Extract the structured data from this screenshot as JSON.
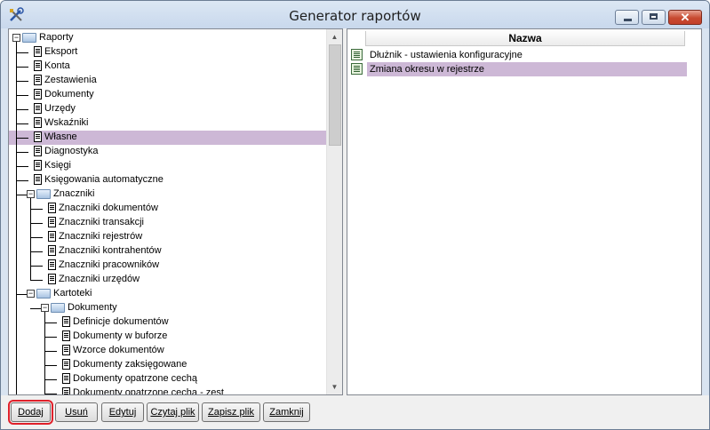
{
  "window": {
    "title": "Generator raportów"
  },
  "tree": [
    {
      "label": "Raporty",
      "type": "folder",
      "depth": 0,
      "expanded": true
    },
    {
      "label": "Eksport",
      "type": "doc",
      "depth": 1
    },
    {
      "label": "Konta",
      "type": "doc",
      "depth": 1
    },
    {
      "label": "Zestawienia",
      "type": "doc",
      "depth": 1
    },
    {
      "label": "Dokumenty",
      "type": "doc",
      "depth": 1
    },
    {
      "label": "Urzędy",
      "type": "doc",
      "depth": 1
    },
    {
      "label": "Wskaźniki",
      "type": "doc",
      "depth": 1
    },
    {
      "label": "Własne",
      "type": "doc",
      "depth": 1,
      "selected": true
    },
    {
      "label": "Diagnostyka",
      "type": "doc",
      "depth": 1
    },
    {
      "label": "Księgi",
      "type": "doc",
      "depth": 1
    },
    {
      "label": "Księgowania automatyczne",
      "type": "doc",
      "depth": 1
    },
    {
      "label": "Znaczniki",
      "type": "folder",
      "depth": 1,
      "expanded": true
    },
    {
      "label": "Znaczniki dokumentów",
      "type": "doc",
      "depth": 2
    },
    {
      "label": "Znaczniki transakcji",
      "type": "doc",
      "depth": 2
    },
    {
      "label": "Znaczniki rejestrów",
      "type": "doc",
      "depth": 2
    },
    {
      "label": "Znaczniki kontrahentów",
      "type": "doc",
      "depth": 2
    },
    {
      "label": "Znaczniki pracowników",
      "type": "doc",
      "depth": 2
    },
    {
      "label": "Znaczniki urzędów",
      "type": "doc",
      "depth": 2
    },
    {
      "label": "Kartoteki",
      "type": "folder",
      "depth": 1,
      "expanded": true
    },
    {
      "label": "Dokumenty",
      "type": "folder",
      "depth": 2,
      "expanded": true
    },
    {
      "label": "Definicje dokumentów",
      "type": "doc",
      "depth": 3
    },
    {
      "label": "Dokumenty w buforze",
      "type": "doc",
      "depth": 3
    },
    {
      "label": "Wzorce dokumentów",
      "type": "doc",
      "depth": 3
    },
    {
      "label": "Dokumenty zaksięgowane",
      "type": "doc",
      "depth": 3
    },
    {
      "label": "Dokumenty opatrzone cechą",
      "type": "doc",
      "depth": 3
    },
    {
      "label": "Dokumenty opatrzone cechą - zest",
      "type": "doc",
      "depth": 3
    }
  ],
  "list": {
    "column_header": "Nazwa",
    "rows": [
      {
        "label": "Dłużnik - ustawienia konfiguracyjne",
        "selected": false
      },
      {
        "label": "Zmiana okresu w rejestrze",
        "selected": true
      }
    ]
  },
  "buttons": {
    "add": "Dodaj",
    "delete": "Usuń",
    "edit": "Edytuj",
    "read_file": "Czytaj plik",
    "save_file": "Zapisz plik",
    "close": "Zamknij"
  },
  "colors": {
    "selection": "#cdb8d6",
    "highlight_outline": "#e0202a"
  }
}
